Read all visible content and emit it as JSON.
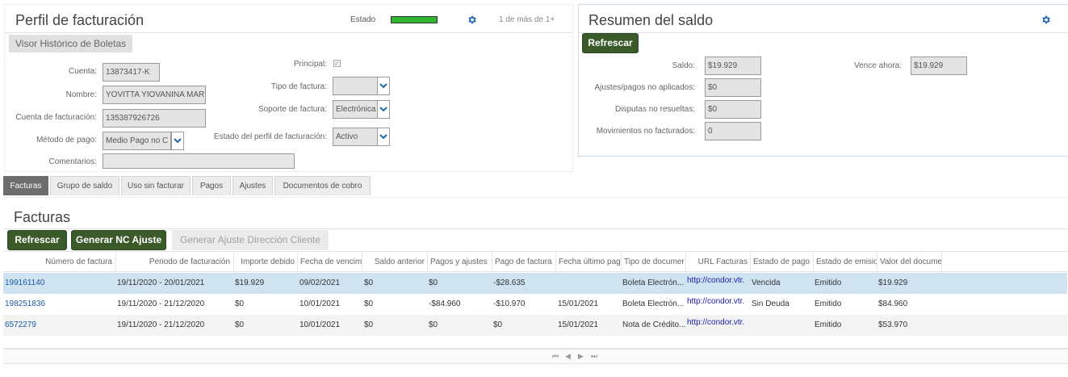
{
  "profile": {
    "title": "Perfil de facturación",
    "estado_label": "Estado",
    "pager": "1 de más de 1+",
    "subtab": "Visor Histórico de Boletas",
    "fields": {
      "cuenta_label": "Cuenta:",
      "cuenta_value": "13873417-K",
      "nombre_label": "Nombre:",
      "nombre_value": "YOVITTA YIOVANINA MAR",
      "cuenta_fact_label": "Cuenta de facturación:",
      "cuenta_fact_value": "135387926726",
      "metodo_label": "Método de pago:",
      "metodo_value": "Medio Pago no C",
      "comentarios_label": "Comentarios:",
      "comentarios_value": "",
      "principal_label": "Principal:",
      "principal_checked": true,
      "tipo_label": "Tipo de factura:",
      "tipo_value": "",
      "soporte_label": "Soporte de factura:",
      "soporte_value": "Electrónica",
      "estado_perfil_label": "Estado del perfil de facturación:",
      "estado_perfil_value": "Activo"
    }
  },
  "summary": {
    "title": "Resumen del saldo",
    "refresh_label": "Refrescar",
    "saldo_label": "Saldo:",
    "saldo_value": "$19.929",
    "vence_label": "Vence ahora:",
    "vence_value": "$19.929",
    "ajustes_label": "Ajustes/pagos no aplicados:",
    "ajustes_value": "$0",
    "disputas_label": "Disputas no resueltas:",
    "disputas_value": "$0",
    "movimientos_label": "Movimientos no facturados:",
    "movimientos_value": "0"
  },
  "tabs": [
    {
      "label": "Facturas",
      "active": true
    },
    {
      "label": "Grupo de saldo",
      "active": false
    },
    {
      "label": "Uso sin facturar",
      "active": false
    },
    {
      "label": "Pagos",
      "active": false
    },
    {
      "label": "Ajustes",
      "active": false
    },
    {
      "label": "Documentos de cobro",
      "active": false
    }
  ],
  "invoices": {
    "title": "Facturas",
    "refresh_label": "Refrescar",
    "generar_nc_label": "Generar NC Ajuste",
    "generar_ajuste_label": "Generar Ajuste Dirección Cliente",
    "columns": [
      "Número de factura",
      "Periodo de facturación",
      "Importe debido",
      "Fecha de vencim",
      "Saldo anterior",
      "Pagos y ajustes",
      "Pago de factura",
      "Fecha último pag",
      "Tipo de documer",
      "URL Facturas",
      "Estado de pago",
      "Estado de emisio",
      "Valor del docume"
    ],
    "rows": [
      [
        "199161140",
        "19/11/2020 - 20/01/2021",
        "$19.929",
        "09/02/2021",
        "$0",
        "$0",
        "-$28.635",
        "",
        "Boleta Electrón...",
        "http://condor.vtr.",
        "Vencida",
        "Emitido",
        "$19.929"
      ],
      [
        "198251836",
        "19/11/2020 - 21/12/2020",
        "$0",
        "10/01/2021",
        "$0",
        "-$84.960",
        "-$10.970",
        "15/01/2021",
        "Boleta Electrón...",
        "http://condor.vtr.",
        "Sin Deuda",
        "Emitido",
        "$84.960"
      ],
      [
        "6572279",
        "19/11/2020 - 21/12/2020",
        "$0",
        "10/01/2021",
        "$0",
        "$0",
        "$0",
        "15/01/2021",
        "Nota de Crédito...",
        "http://condor.vtr.",
        "",
        "Emitido",
        "$53.970"
      ]
    ],
    "pager_icons": [
      "first-page-icon",
      "prev-page-icon",
      "next-page-icon",
      "last-page-icon"
    ]
  },
  "colors": {
    "accent_dark_green": "#3a5a2a",
    "status_green": "#2fb52f",
    "selected_row": "#cfe3f1",
    "gear_blue": "#1f67b5",
    "active_tab": "#6d6d6d"
  }
}
